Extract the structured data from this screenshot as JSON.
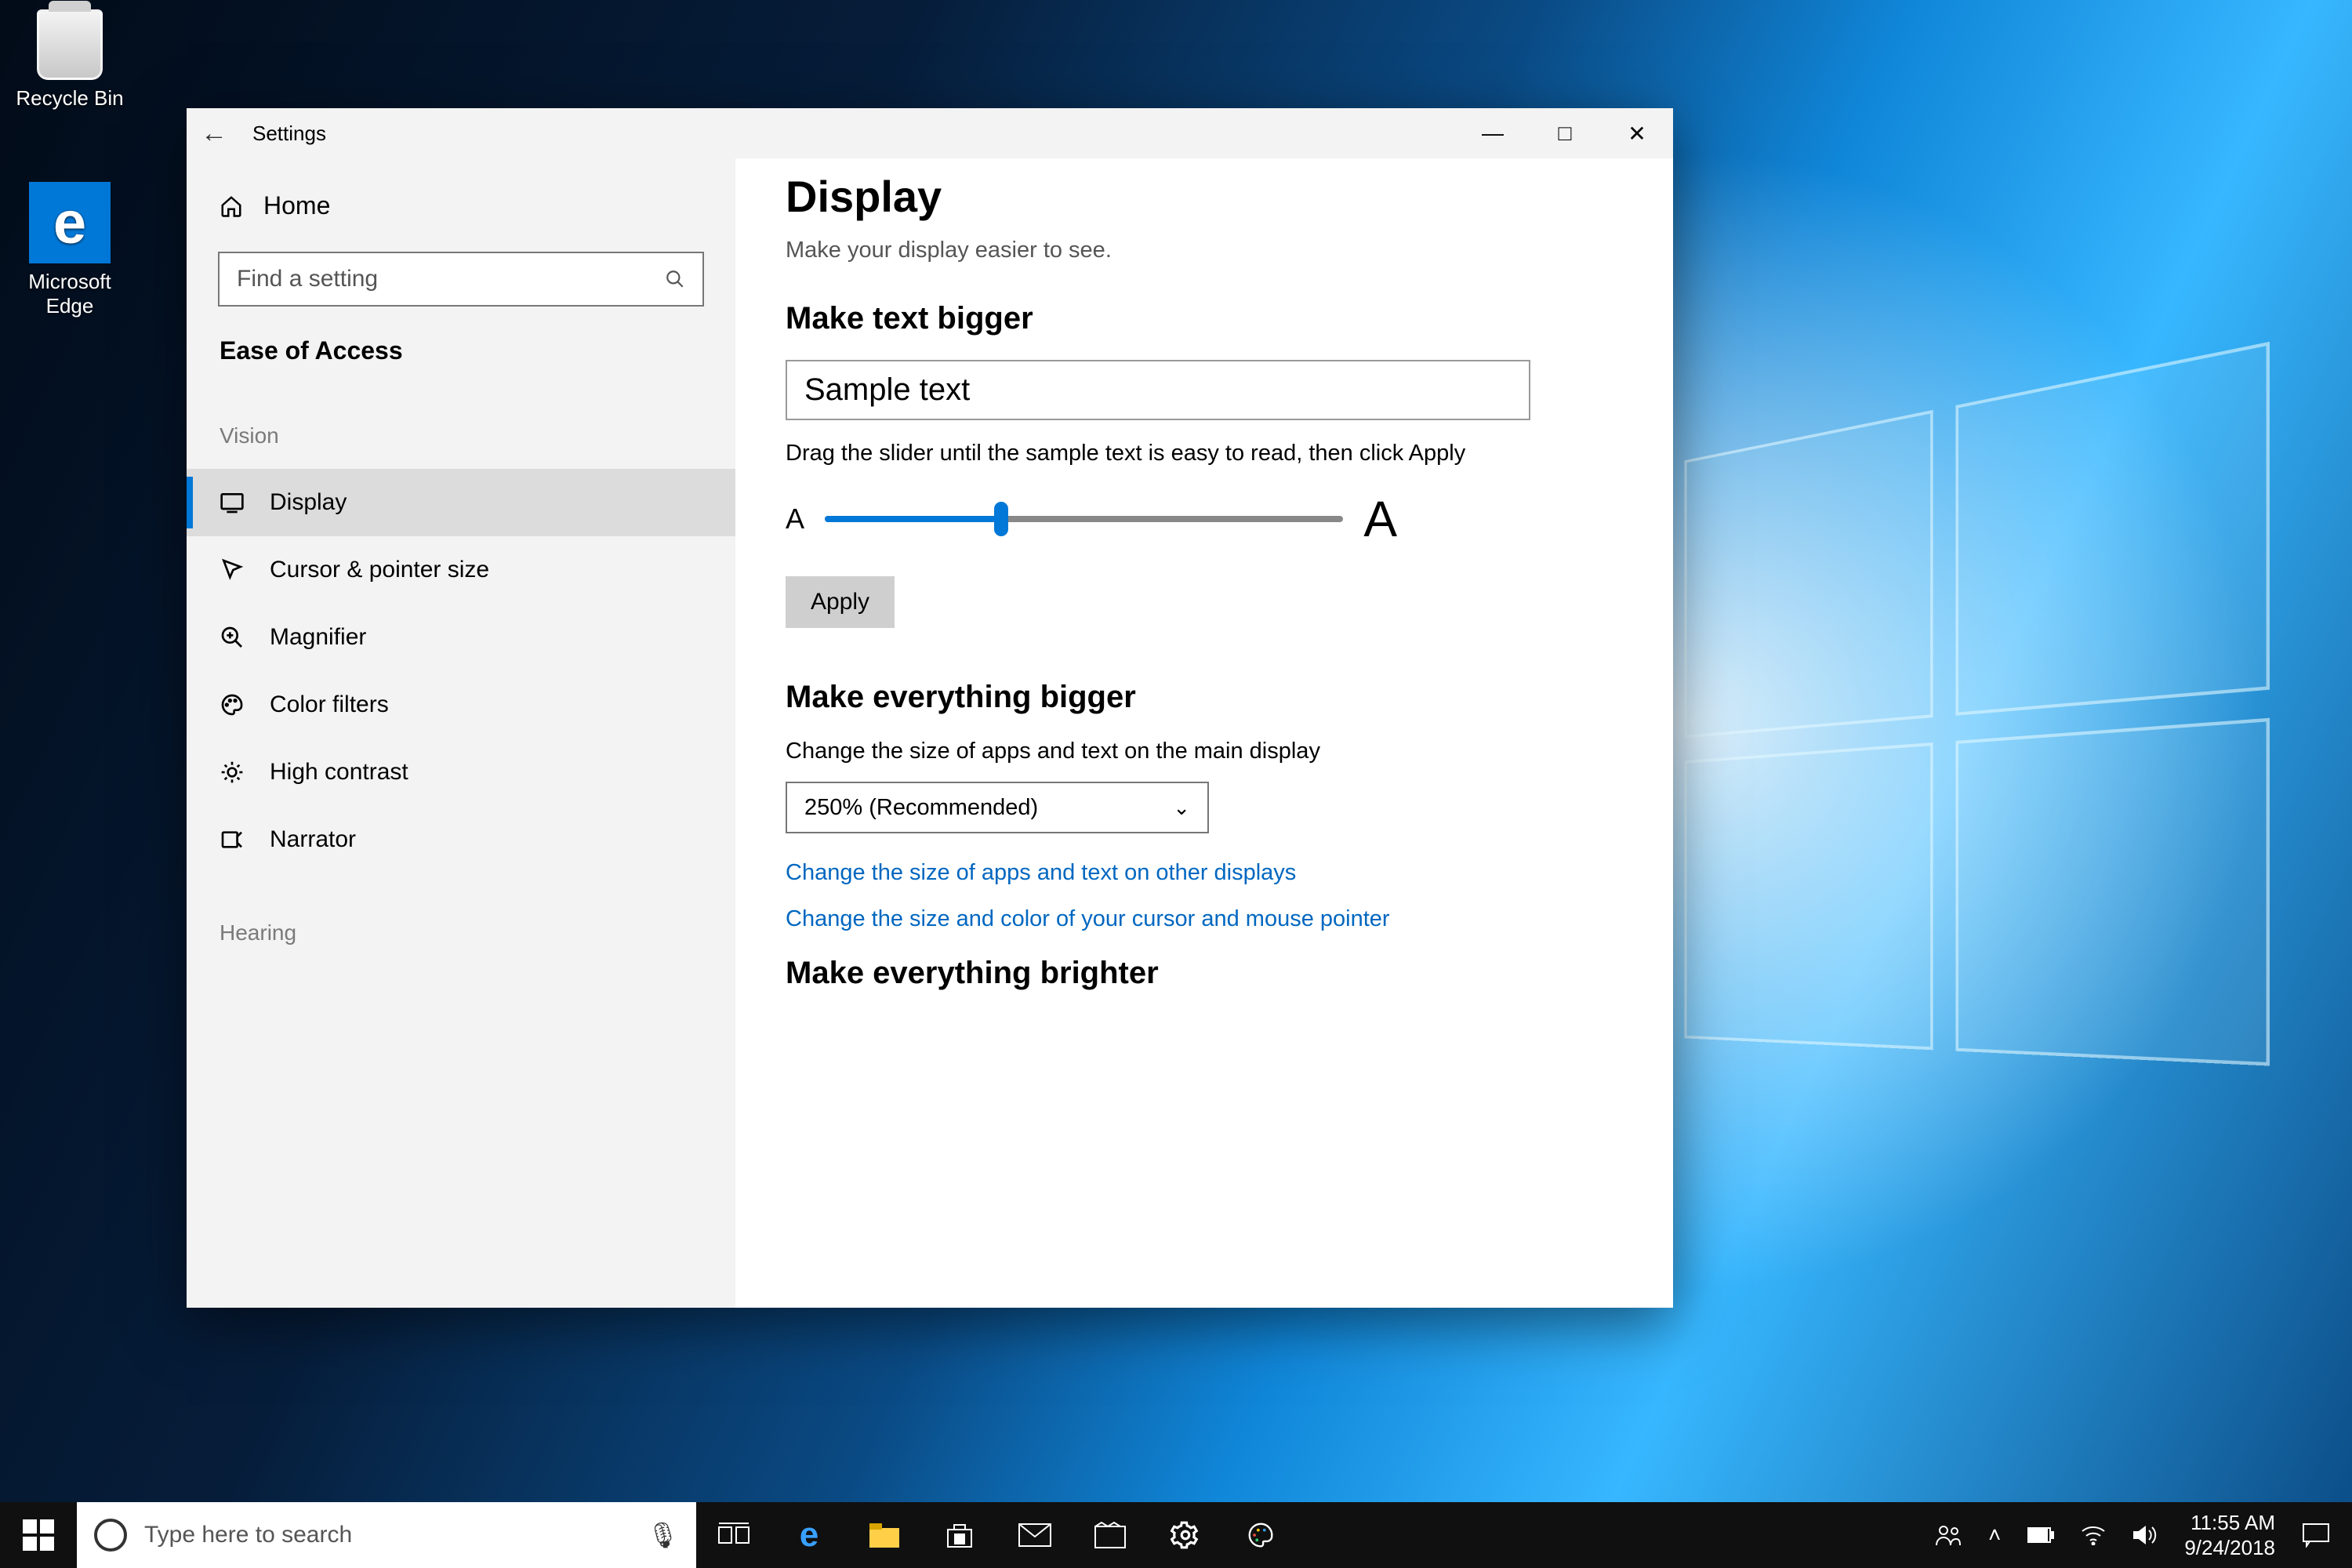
{
  "desktop": {
    "icons": {
      "recycle_bin": "Recycle Bin",
      "edge": "Microsoft Edge",
      "edge_glyph": "e"
    }
  },
  "settings": {
    "title": "Settings",
    "home": "Home",
    "search_placeholder": "Find a setting",
    "section": "Ease of Access",
    "groups": {
      "vision": "Vision",
      "hearing": "Hearing"
    },
    "nav": {
      "display": "Display",
      "cursor": "Cursor & pointer size",
      "magnifier": "Magnifier",
      "color_filters": "Color filters",
      "high_contrast": "High contrast",
      "narrator": "Narrator"
    },
    "content": {
      "heading": "Display",
      "subtitle": "Make your display easier to see.",
      "text_bigger_heading": "Make text bigger",
      "sample_text": "Sample text",
      "slider_hint": "Drag the slider until the sample text is easy to read, then click Apply",
      "small_a": "A",
      "big_a": "A",
      "apply": "Apply",
      "everything_bigger_heading": "Make everything bigger",
      "scale_desc": "Change the size of apps and text on the main display",
      "scale_value": "250% (Recommended)",
      "link_other_displays": "Change the size of apps and text on other displays",
      "link_cursor": "Change the size and color of your cursor and mouse pointer",
      "brighter_heading": "Make everything brighter"
    },
    "window_controls": {
      "min": "—",
      "max": "□",
      "close": "✕"
    }
  },
  "taskbar": {
    "search_placeholder": "Type here to search",
    "tray": {
      "people": "👥",
      "chevron": "˄",
      "battery": "▯",
      "wifi": "⋰",
      "volume": "🔊",
      "time": "11:55 AM",
      "date": "9/24/2018"
    }
  }
}
